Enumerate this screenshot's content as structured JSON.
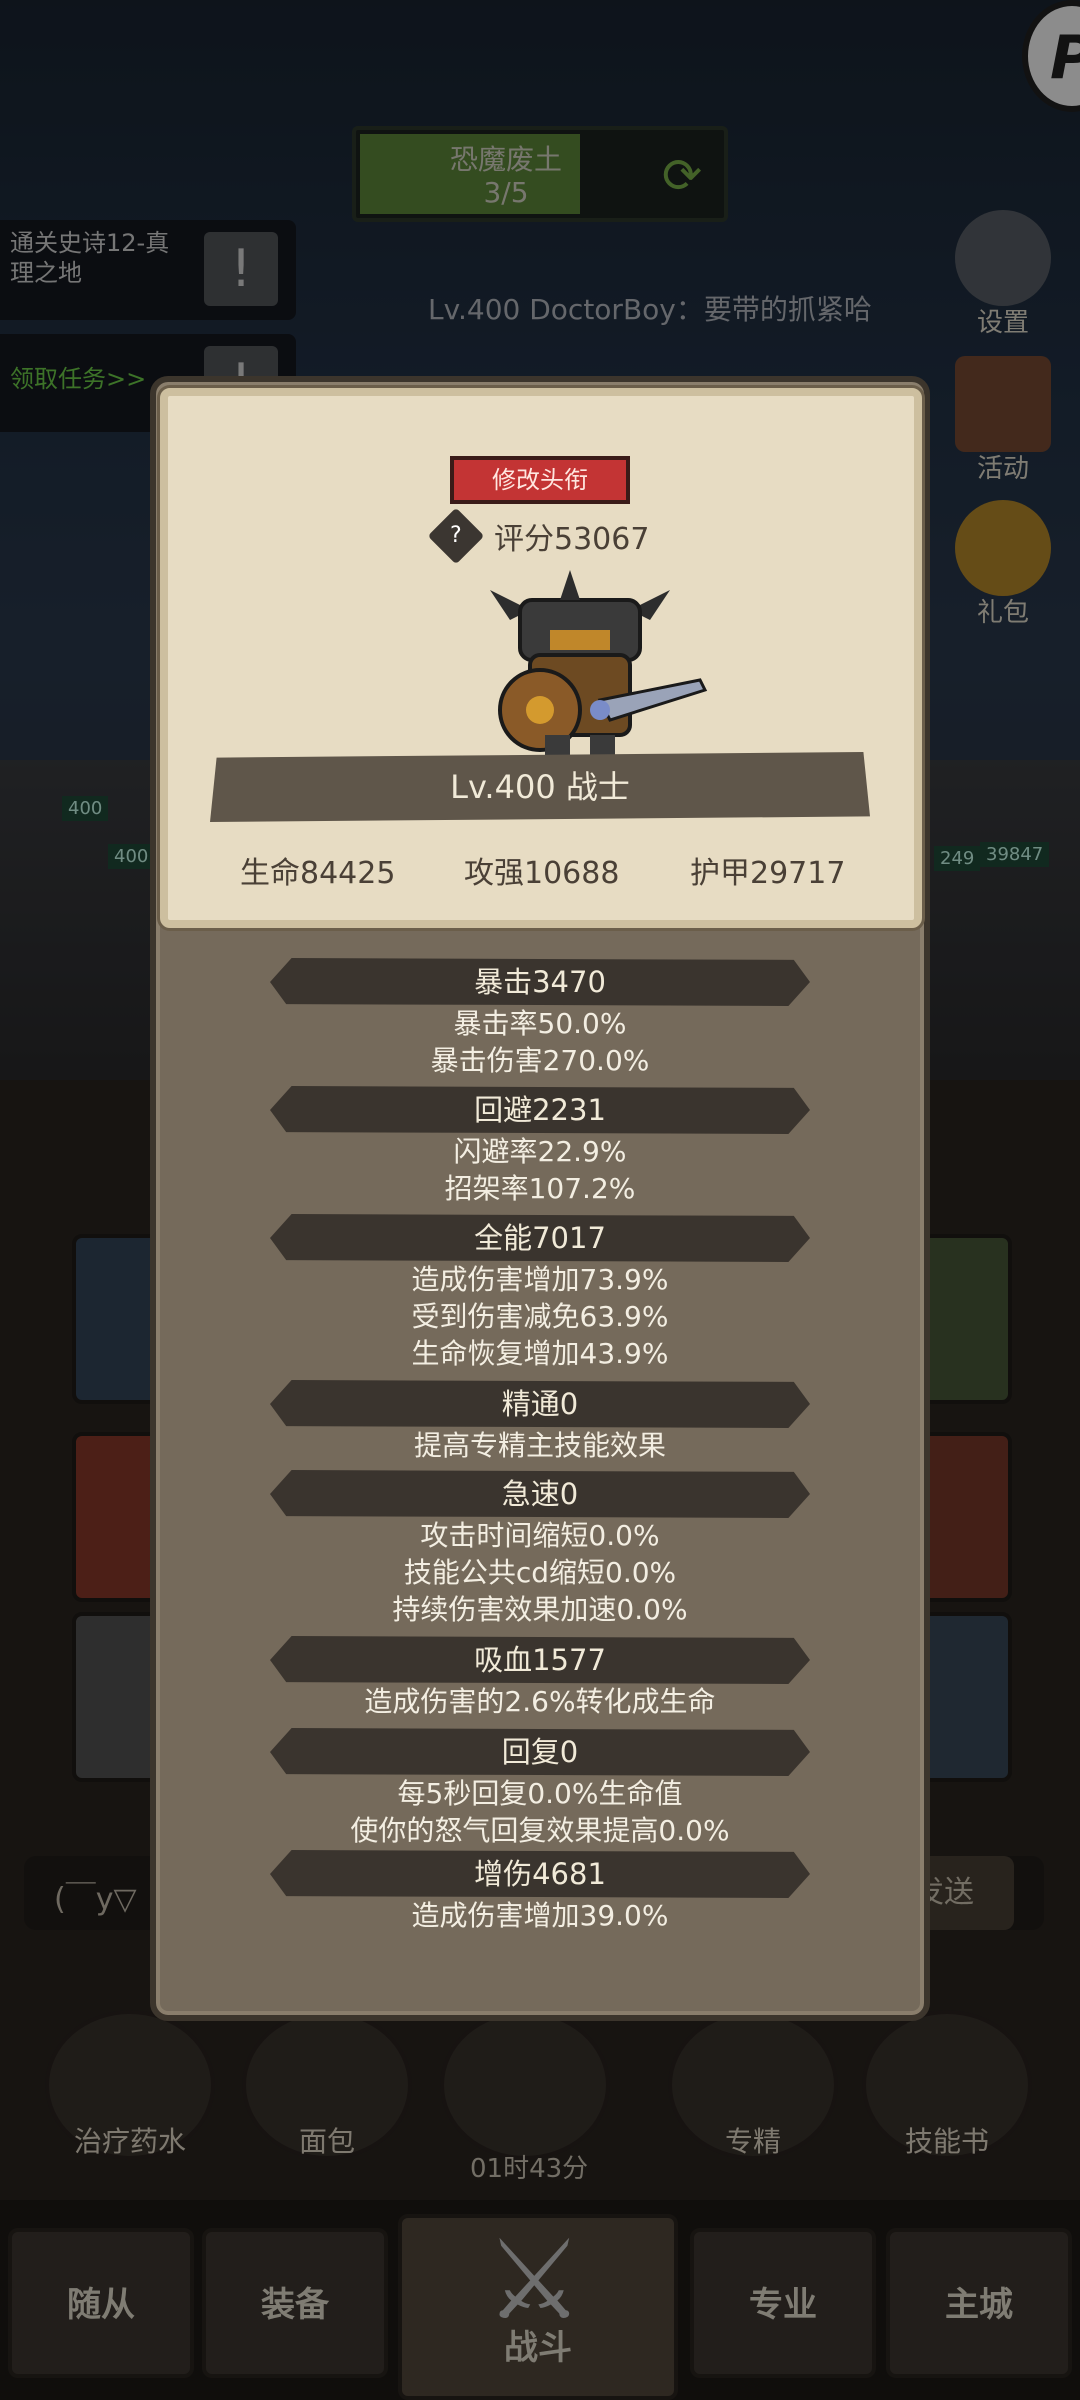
{
  "quest": {
    "name": "恐魔废土",
    "progress": "3/5",
    "fill_fraction": 0.6
  },
  "tasks": [
    {
      "text": "通关史诗12-真理之地"
    },
    {
      "text": "领取任务>>"
    }
  ],
  "chat_message": "Lv.400 DoctorBoy：要带的抓紧哈",
  "right_menu": [
    {
      "label": "设置",
      "icon": "gear-icon"
    },
    {
      "label": "活动",
      "icon": "activity-board-icon"
    },
    {
      "label": "礼包",
      "icon": "gift-pot-icon"
    }
  ],
  "field_badges": [
    "400",
    "400",
    "249",
    "39847"
  ],
  "chat_input": {
    "placeholder": "(￣y▽",
    "send": "发送"
  },
  "consumables": [
    {
      "label": "治疗药水",
      "icon": "potion-icon"
    },
    {
      "label": "面包",
      "icon": "bread-icon"
    },
    {
      "label": "",
      "icon": "treasure-chest-icon"
    },
    {
      "label": "专精",
      "icon": "specialization-icon"
    },
    {
      "label": "技能书",
      "icon": "skill-book-icon"
    }
  ],
  "timer": "01时43分",
  "nav": [
    "随从",
    "装备",
    "战斗",
    "专业",
    "主城"
  ],
  "panel": {
    "title_button": "修改头衔",
    "score": "评分53067",
    "name": "Lv.400 战士",
    "base_stats": {
      "hp": "生命84425",
      "attack": "攻强10688",
      "armor": "护甲29717"
    },
    "stats": [
      {
        "header": "暴击3470",
        "lines": [
          "暴击率50.0%",
          "暴击伤害270.0%"
        ]
      },
      {
        "header": "回避2231",
        "lines": [
          "闪避率22.9%",
          "招架率107.2%"
        ]
      },
      {
        "header": "全能7017",
        "lines": [
          "造成伤害增加73.9%",
          "受到伤害减免63.9%",
          "生命恢复增加43.9%"
        ]
      },
      {
        "header": "精通0",
        "lines": [
          "提高专精主技能效果"
        ]
      },
      {
        "header": "急速0",
        "lines": [
          "攻击时间缩短0.0%",
          "技能公共cd缩短0.0%",
          "持续伤害效果加速0.0%"
        ]
      },
      {
        "header": "吸血1577",
        "lines": [
          "造成伤害的2.6%转化成生命"
        ]
      },
      {
        "header": "回复0",
        "lines": [
          "每5秒回复0.0%生命值",
          "使你的怒气回复效果提高0.0%"
        ]
      },
      {
        "header": "增伤4681",
        "lines": [
          "造成伤害增加39.0%"
        ]
      }
    ]
  },
  "colors": {
    "title_button": "#c33434",
    "panel": "#756a5b",
    "card": "#e7dcc3"
  }
}
